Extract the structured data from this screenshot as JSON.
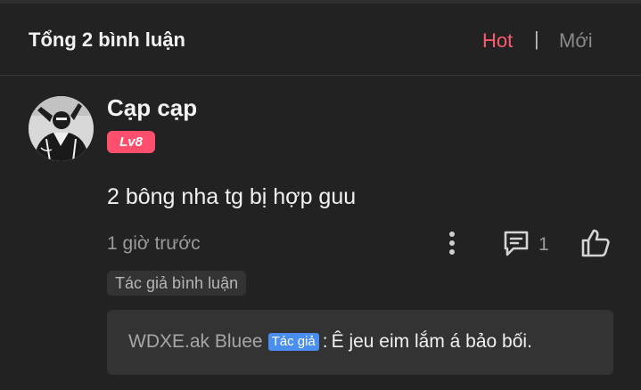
{
  "header": {
    "title": "Tổng 2 bình luận",
    "sort_hot": "Hot",
    "sort_separator": "|",
    "sort_new": "Mới",
    "hot_color": "#ff5a72"
  },
  "comment": {
    "avatar_icon": "user-avatar-photo",
    "username": "Cạp cạp",
    "level": "Lv8",
    "level_color": "#ff4f6d",
    "text": "2 bông nha tg bị hợp guu",
    "timestamp": "1 giờ trước",
    "more_icon": "more-vertical-icon",
    "reply_icon": "comment-icon",
    "reply_count": "1",
    "like_icon": "thumbs-up-icon",
    "author_tag": "Tác giả bình luận"
  },
  "reply": {
    "author": "WDXE.ak Bluee",
    "author_tag": "Tác giả",
    "author_tag_color": "#4a8ef2",
    "separator": ":",
    "content": "Ê jeu eim lắm á bảo bối."
  }
}
